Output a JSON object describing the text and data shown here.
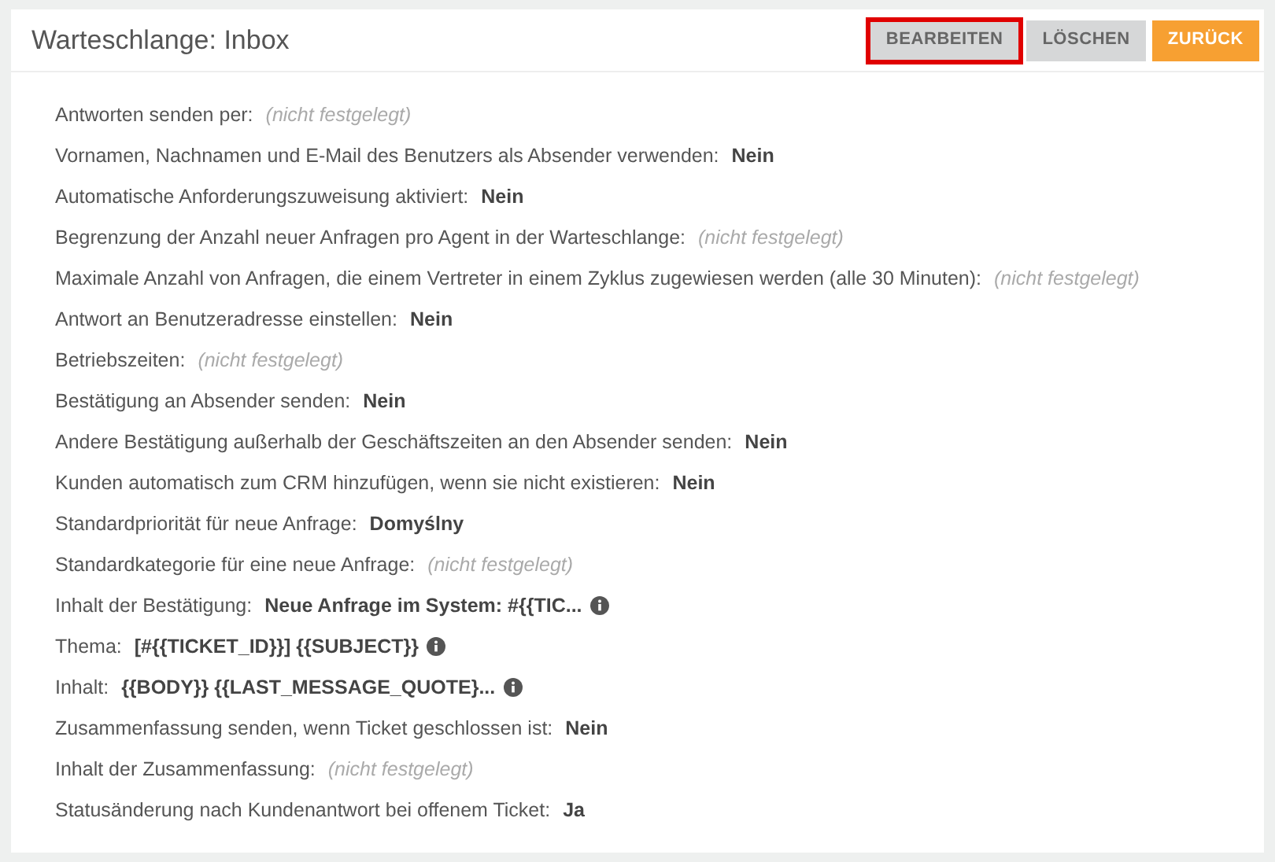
{
  "header": {
    "title": "Warteschlange: Inbox"
  },
  "buttons": [
    {
      "label": "BEARBEITEN",
      "kind": "secondary",
      "highlighted": true
    },
    {
      "label": "LÖSCHEN",
      "kind": "secondary",
      "highlighted": false
    },
    {
      "label": "ZURÜCK",
      "kind": "primary",
      "highlighted": false
    }
  ],
  "fields": [
    {
      "label": "Antworten senden per:",
      "value": "(nicht festgelegt)",
      "kind": "unset",
      "info": false
    },
    {
      "label": "Vornamen, Nachnamen und E-Mail des Benutzers als Absender verwenden:",
      "value": "Nein",
      "kind": "value",
      "info": false
    },
    {
      "label": "Automatische Anforderungszuweisung aktiviert:",
      "value": "Nein",
      "kind": "value",
      "info": false
    },
    {
      "label": "Begrenzung der Anzahl neuer Anfragen pro Agent in der Warteschlange:",
      "value": "(nicht festgelegt)",
      "kind": "unset",
      "info": false
    },
    {
      "label": "Maximale Anzahl von Anfragen, die einem Vertreter in einem Zyklus zugewiesen werden (alle 30 Minuten):",
      "value": "(nicht festgelegt)",
      "kind": "unset",
      "info": false
    },
    {
      "label": "Antwort an Benutzeradresse einstellen:",
      "value": "Nein",
      "kind": "value",
      "info": false
    },
    {
      "label": "Betriebszeiten:",
      "value": "(nicht festgelegt)",
      "kind": "unset",
      "info": false
    },
    {
      "label": "Bestätigung an Absender senden:",
      "value": "Nein",
      "kind": "value",
      "info": false
    },
    {
      "label": "Andere Bestätigung außerhalb der Geschäftszeiten an den Absender senden:",
      "value": "Nein",
      "kind": "value",
      "info": false
    },
    {
      "label": "Kunden automatisch zum CRM hinzufügen, wenn sie nicht existieren:",
      "value": "Nein",
      "kind": "value",
      "info": false
    },
    {
      "label": "Standardpriorität für neue Anfrage:",
      "value": "Domyślny",
      "kind": "value",
      "info": false
    },
    {
      "label": "Standardkategorie für eine neue Anfrage:",
      "value": "(nicht festgelegt)",
      "kind": "unset",
      "info": false
    },
    {
      "label": "Inhalt der Bestätigung:",
      "value": "Neue Anfrage im System: #{{TIC...",
      "kind": "value",
      "info": true
    },
    {
      "label": "Thema:",
      "value": "[#{{TICKET_ID}}] {{SUBJECT}}",
      "kind": "value",
      "info": true
    },
    {
      "label": "Inhalt:",
      "value": "{{BODY}} {{LAST_MESSAGE_QUOTE}...",
      "kind": "value",
      "info": true
    },
    {
      "label": "Zusammenfassung senden, wenn Ticket geschlossen ist:",
      "value": "Nein",
      "kind": "value",
      "info": false
    },
    {
      "label": "Inhalt der Zusammenfassung:",
      "value": "(nicht festgelegt)",
      "kind": "unset",
      "info": false
    },
    {
      "label": "Statusänderung nach Kundenantwort bei offenem Ticket:",
      "value": "Ja",
      "kind": "value",
      "info": false
    }
  ]
}
